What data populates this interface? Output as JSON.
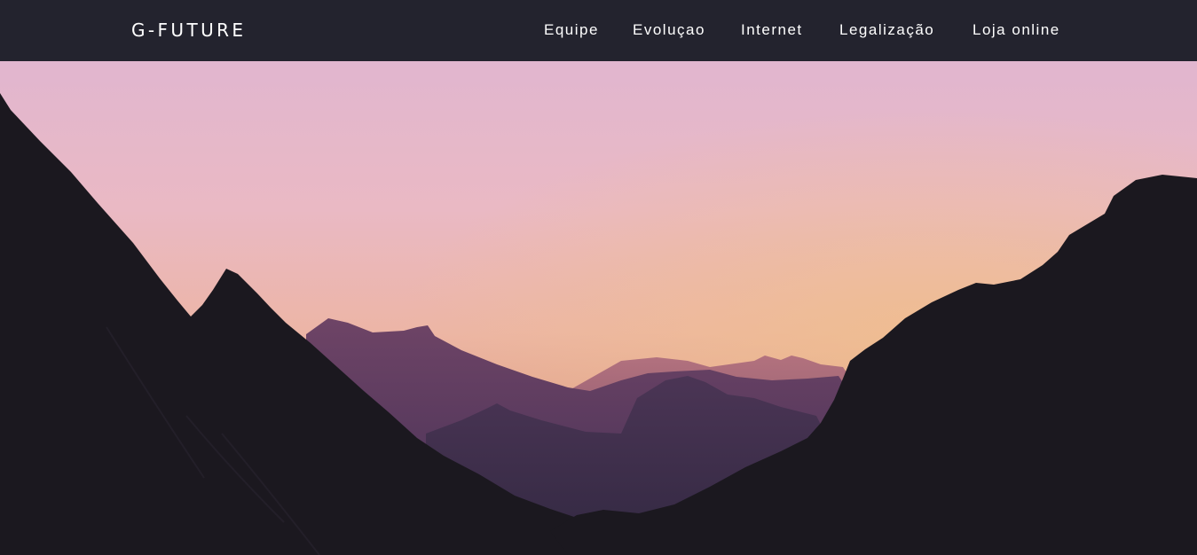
{
  "header": {
    "brand": "G-FUTURE",
    "nav": [
      {
        "label": "Equipe"
      },
      {
        "label": "Evoluçao"
      },
      {
        "label": "Internet"
      },
      {
        "label": "Legalização"
      },
      {
        "label": "Loja online"
      }
    ]
  },
  "colors": {
    "navbar_background": "#23232e",
    "nav_text": "#ffffff",
    "sky_top": "#e1b6cf",
    "sky_horizon": "#edb48e",
    "mountain_foreground": "#1b181f",
    "mountain_midground": "#4b3658",
    "mountain_far": "#8d5a72"
  },
  "hero": {
    "image_subject": "mountain-valley-sunset-image"
  }
}
